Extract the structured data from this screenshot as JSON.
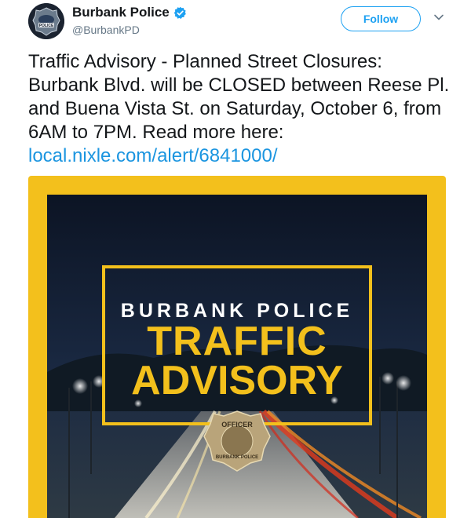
{
  "account": {
    "name": "Burbank Police",
    "handle": "@BurbankPD",
    "avatar_icon": "police-badge",
    "verified_icon": "verified-badge-icon"
  },
  "actions": {
    "follow_label": "Follow",
    "menu_icon": "chevron-down-icon"
  },
  "tweet": {
    "text": "Traffic Advisory - Planned Street Closures: Burbank Blvd. will be CLOSED between Reese Pl. and Buena Vista St. on Saturday, October 6, from 6AM to 7PM. Read more here:",
    "link": "local.nixle.com/alert/6841000/"
  },
  "media": {
    "line1": "BURBANK POLICE",
    "line2": "TRAFFIC",
    "line3": "ADVISORY",
    "badge_icon": "officer-badge",
    "badge_text_top": "OFFICER",
    "badge_text_bottom": "BURBANK POLICE"
  },
  "colors": {
    "accent": "#1da1f2",
    "link": "#1b95e0",
    "frame_yellow": "#f3c01c",
    "night_sky": "#0f1828"
  }
}
